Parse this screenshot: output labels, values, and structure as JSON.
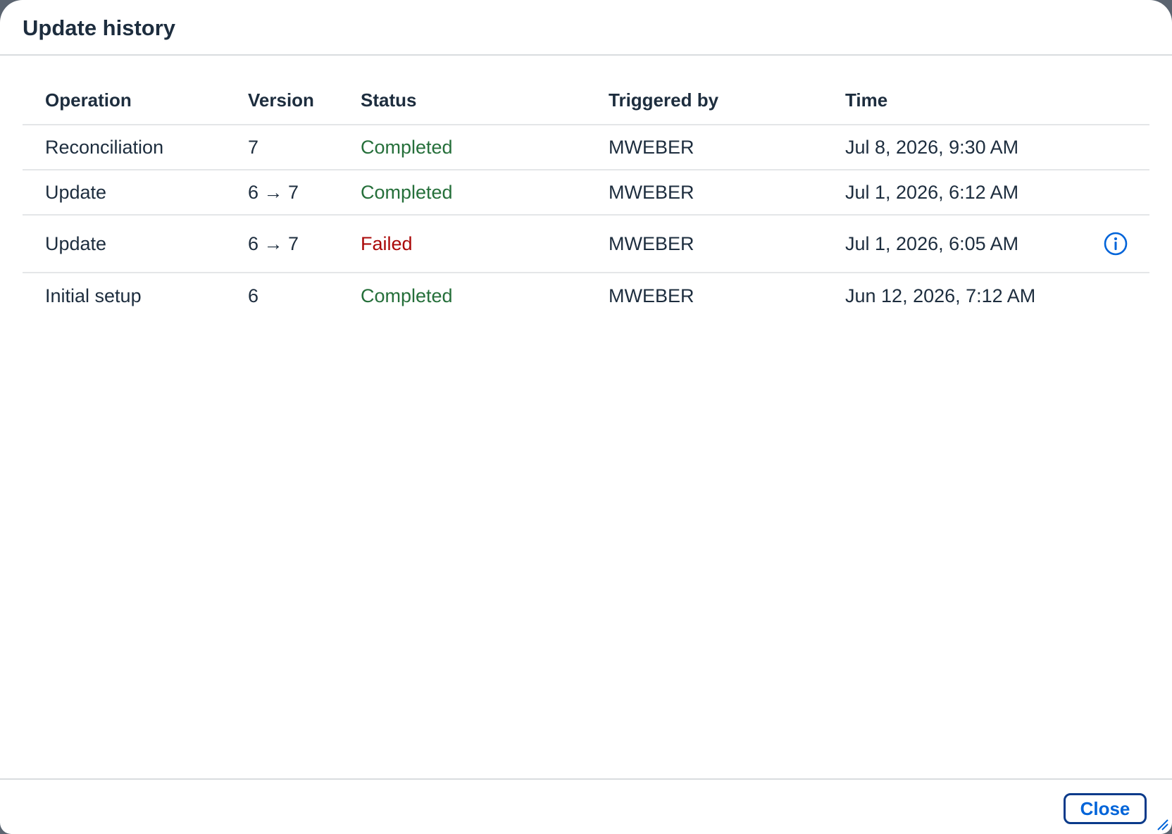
{
  "dialog": {
    "title": "Update history",
    "close_label": "Close"
  },
  "table": {
    "columns": [
      "Operation",
      "Version",
      "Status",
      "Triggered by",
      "Time"
    ],
    "rows": [
      {
        "operation": "Reconciliation",
        "version": "7",
        "status": "Completed",
        "triggered_by": "MWEBER",
        "time": "Jul 8, 2026, 9:30 AM",
        "has_info": false
      },
      {
        "operation": "Update",
        "version": "6 → 7",
        "status": "Completed",
        "triggered_by": "MWEBER",
        "time": "Jul 1, 2026, 6:12 AM",
        "has_info": false
      },
      {
        "operation": "Update",
        "version": "6 → 7",
        "status": "Failed",
        "triggered_by": "MWEBER",
        "time": "Jul 1, 2026, 6:05 AM",
        "has_info": true,
        "info_icon": "info-icon"
      },
      {
        "operation": "Initial setup",
        "version": "6",
        "status": "Completed",
        "triggered_by": "MWEBER",
        "time": "Jun 12, 2026, 7:12 AM",
        "has_info": false
      }
    ]
  },
  "colors": {
    "completed": "#256f3a",
    "failed": "#aa0808",
    "accent": "#0064d9",
    "text": "#1d2d3e"
  }
}
